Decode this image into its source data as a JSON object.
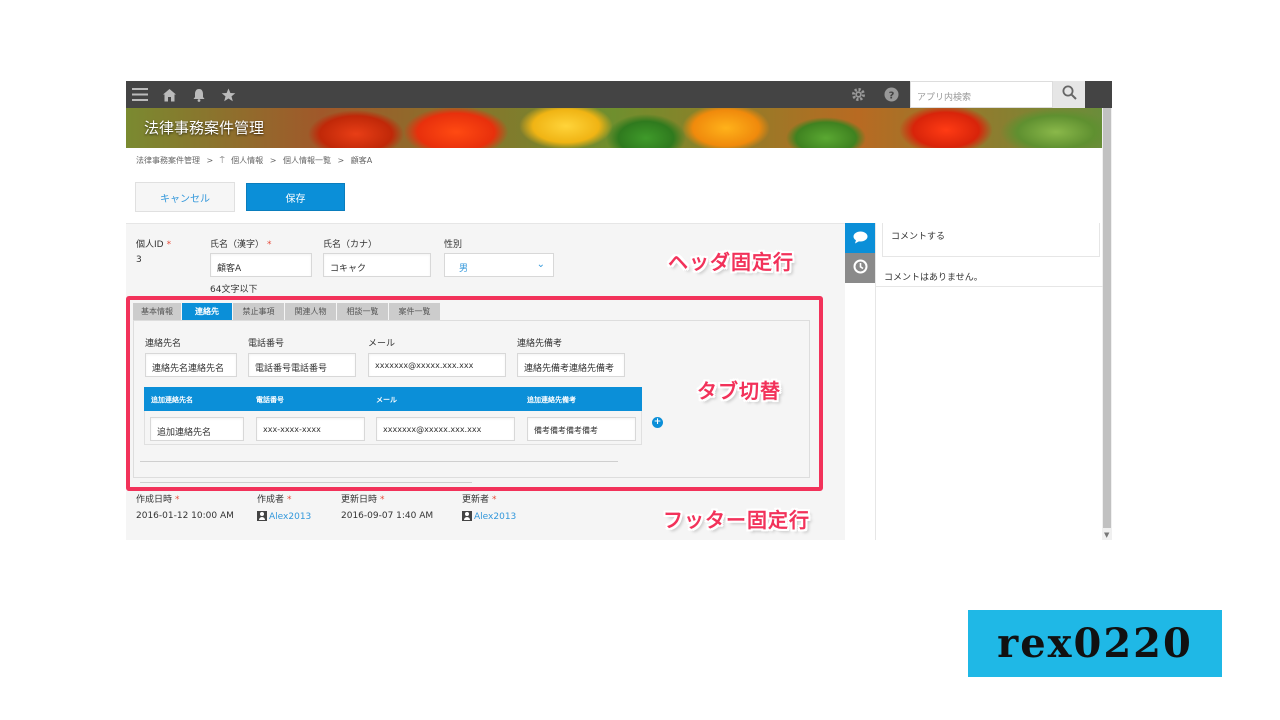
{
  "topbar": {
    "search_placeholder": "アプリ内検索"
  },
  "header": {
    "app_title": "法律事務案件管理"
  },
  "breadcrumb": [
    "法律事務案件管理",
    ">",
    "個人情報",
    ">",
    "個人情報一覧",
    ">",
    "顧客A"
  ],
  "actions": {
    "cancel_label": "キャンセル",
    "save_label": "保存"
  },
  "header_fields": {
    "personal_id_label": "個人ID",
    "personal_id_value": "3",
    "name_kanji_label": "氏名（漢字）",
    "name_kanji_value": "顧客A",
    "name_kanji_hint": "64文字以下",
    "name_kana_label": "氏名（カナ）",
    "name_kana_value": "コキャク",
    "gender_label": "性別",
    "gender_value": "男",
    "required_mark": "*"
  },
  "tabs": [
    {
      "label": "基本情報",
      "active": false
    },
    {
      "label": "連絡先",
      "active": true
    },
    {
      "label": "禁止事項",
      "active": false
    },
    {
      "label": "関連人物",
      "active": false
    },
    {
      "label": "相談一覧",
      "active": false
    },
    {
      "label": "案件一覧",
      "active": false
    }
  ],
  "contact": {
    "name_label": "連絡先名",
    "name_value": "連絡先名連絡先名",
    "phone_label": "電話番号",
    "phone_value": "電話番号電話番号",
    "mail_label": "メール",
    "mail_value": "xxxxxxx@xxxxx.xxx.xxx",
    "remarks_label": "連絡先備考",
    "remarks_value": "連絡先備考連絡先備考"
  },
  "subtable": {
    "headers": [
      "追加連絡先名",
      "電話番号",
      "メール",
      "追加連絡先備考"
    ],
    "row": [
      "追加連絡先名",
      "xxx-xxxx-xxxx",
      "xxxxxxx@xxxxx.xxx.xxx",
      "備考備考備考備考"
    ],
    "add_symbol": "+"
  },
  "footer_fields": {
    "created_at_label": "作成日時",
    "created_at_value": "2016-01-12 10:00 AM",
    "creator_label": "作成者",
    "creator_value": "Alex2013",
    "updated_at_label": "更新日時",
    "updated_at_value": "2016-09-07 1:40 AM",
    "updater_label": "更新者",
    "updater_value": "Alex2013",
    "required_mark": "*"
  },
  "comments": {
    "input_placeholder": "コメントする",
    "empty_text": "コメントはありません。"
  },
  "annotations": {
    "header_fixed": "ヘッダ固定行",
    "tab_switch": "タブ切替",
    "footer_fixed": "フッター固定行"
  },
  "badge": {
    "text": "rex0220"
  },
  "colors": {
    "accent": "#0b8fd8",
    "annotation": "#f2325a",
    "badge": "#1fb8e6",
    "topbar": "#444444"
  },
  "icons": [
    "menu-icon",
    "home-icon",
    "bell-icon",
    "star-icon",
    "gear-icon",
    "help-icon",
    "search-icon",
    "comment-icon",
    "history-icon",
    "user-icon"
  ]
}
